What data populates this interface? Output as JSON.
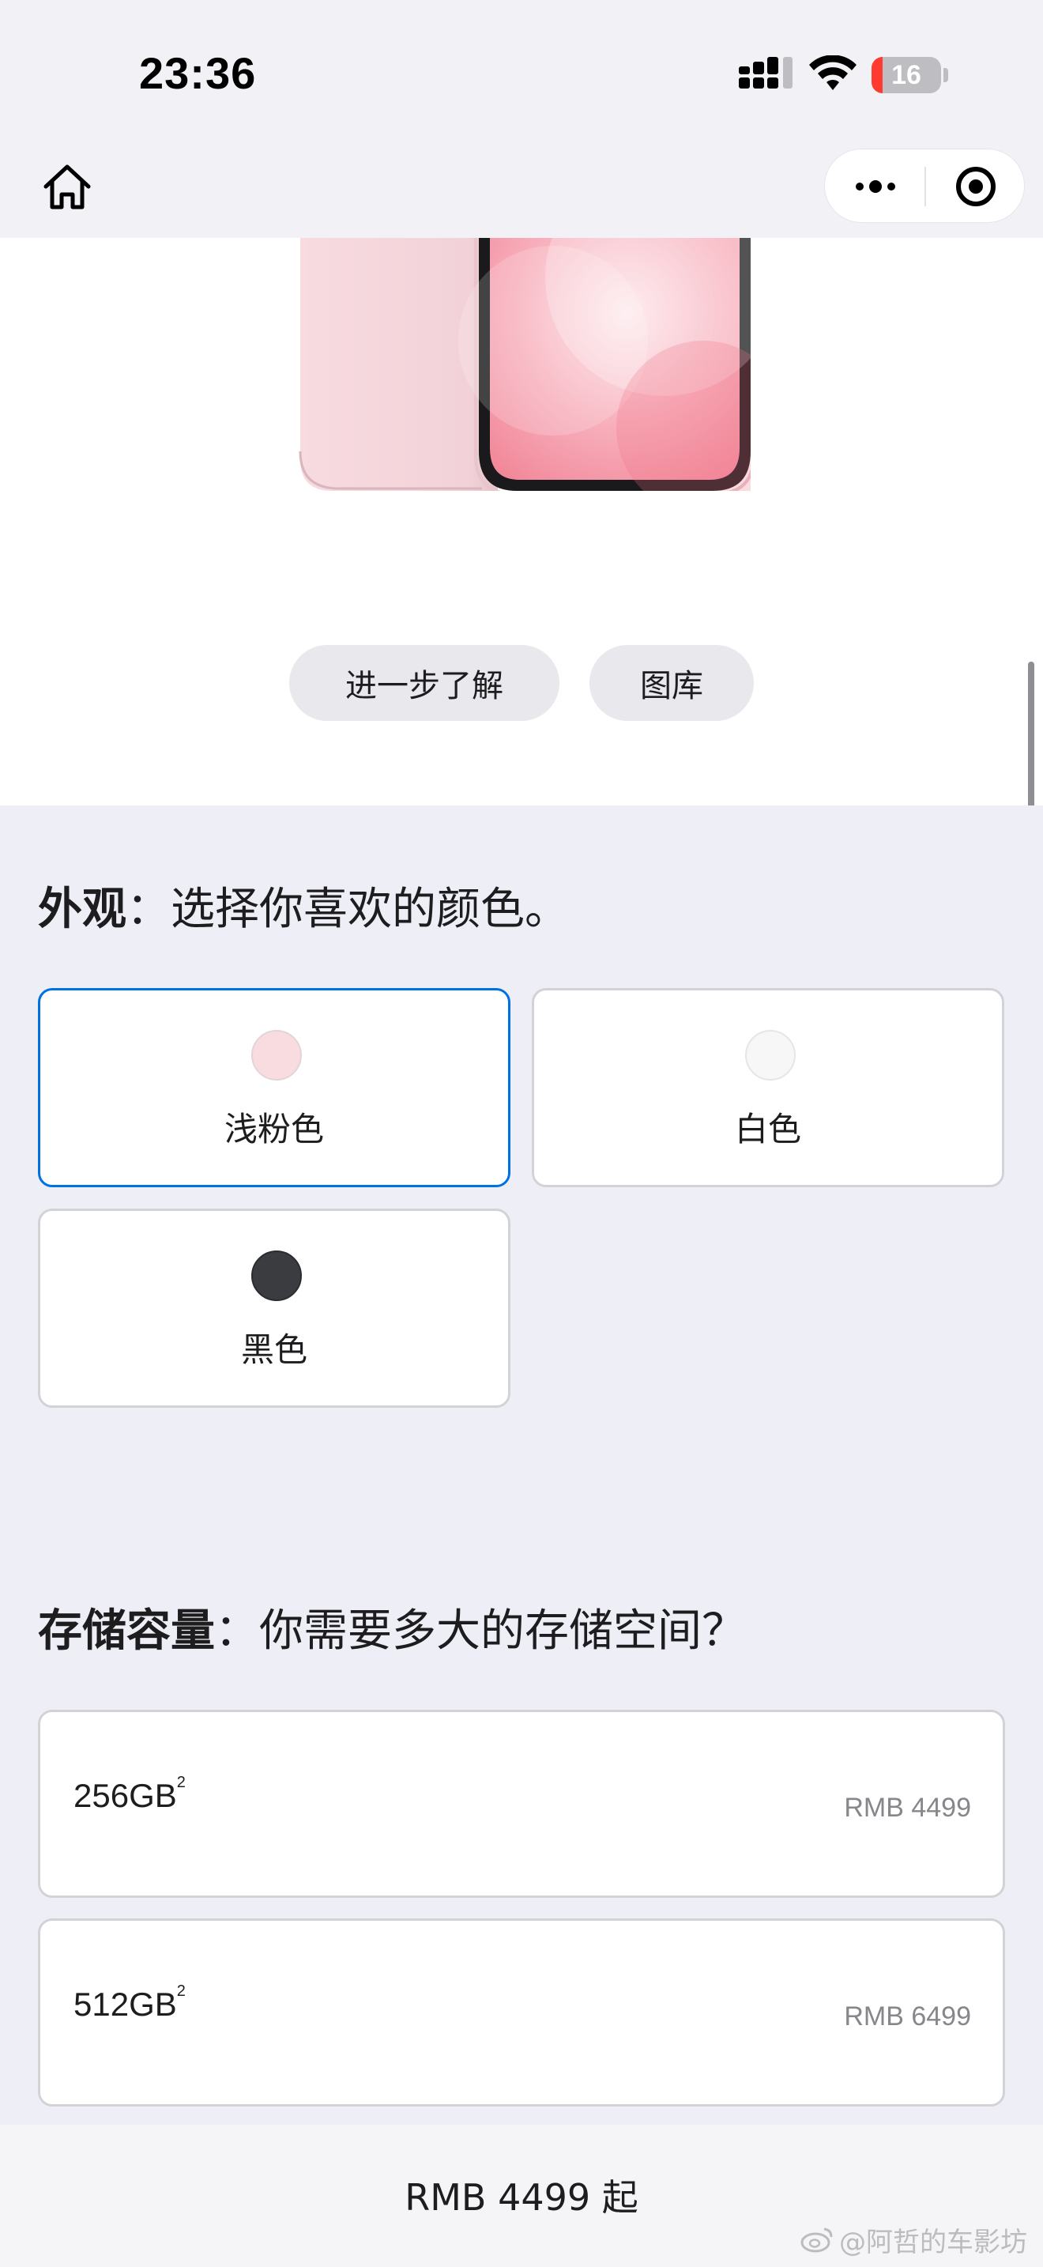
{
  "status_bar": {
    "time": "23:36",
    "battery_level": "16",
    "battery_fraction": 0.16
  },
  "nav": {
    "home_icon": "home-icon",
    "more_icon": "more-dots-icon",
    "close_icon": "target-icon"
  },
  "hero": {
    "image_icon": "iphone-pink-image",
    "learn_more_label": "进一步了解",
    "gallery_label": "图库"
  },
  "appearance": {
    "title_bold": "外观",
    "title_rest": "：选择你喜欢的颜色。",
    "options": [
      {
        "label": "浅粉色",
        "swatch": "#f8dcdf",
        "selected": true
      },
      {
        "label": "白色",
        "swatch": "#f7f7f8",
        "selected": false
      },
      {
        "label": "黑色",
        "swatch": "#3a3c40",
        "selected": false
      }
    ]
  },
  "storage": {
    "title_bold": "存储容量",
    "title_rest": "：你需要多大的存储空间？",
    "options": [
      {
        "capacity": "256GB",
        "footnote": "2",
        "price": "RMB 4499"
      },
      {
        "capacity": "512GB",
        "footnote": "2",
        "price": "RMB 6499"
      }
    ]
  },
  "bottom_bar": {
    "price_text": "RMB 4499 起"
  },
  "watermark": {
    "text": "@阿哲的车影坊"
  },
  "colors": {
    "accent_selected": "#0071e3",
    "battery_low": "#ff3b30",
    "page_background": "#eeeef6"
  }
}
